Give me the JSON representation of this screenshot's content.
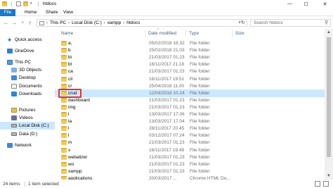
{
  "window": {
    "title": "htdocs",
    "controls": [
      "minimize",
      "maximize",
      "close"
    ],
    "minimize_glyph": "—",
    "maximize_glyph": "☐",
    "close_glyph": "✕"
  },
  "ribbon": {
    "tabs": [
      "File",
      "Home",
      "Share",
      "View"
    ]
  },
  "address_bar": {
    "back_glyph": "←",
    "forward_glyph": "→",
    "dropdown_glyph": "∨",
    "up_glyph": "↑",
    "crumbs": [
      "This PC",
      "Local Disk (C:)",
      "xampp",
      "htdocs"
    ],
    "separator": "›",
    "end_glyph": "∨",
    "refresh_glyph": "↻"
  },
  "search": {
    "placeholder": "Search htdocs",
    "icon": "search-icon",
    "glyph": "⚲"
  },
  "nav_pane": {
    "items": [
      {
        "label": "Quick access",
        "icon": "star-icon"
      },
      {
        "label": "OneDrive",
        "icon": "cloud-icon"
      },
      {
        "label": "This PC",
        "icon": "computer-icon"
      },
      {
        "label": "3D Objects",
        "icon": "cube-icon"
      },
      {
        "label": "Desktop",
        "icon": "desktop-icon"
      },
      {
        "label": "Documents",
        "icon": "documents-icon"
      },
      {
        "label": "Downloads",
        "icon": "download-icon"
      },
      {
        "label": "Pictures",
        "icon": "pictures-icon"
      },
      {
        "label": "Videos",
        "icon": "videos-icon"
      },
      {
        "label": "Local Disk (C:)",
        "icon": "disk-icon"
      },
      {
        "label": "Data (D:)",
        "icon": "disk-icon"
      },
      {
        "label": "Network",
        "icon": "network-icon"
      }
    ],
    "selected": "Local Disk (C:)"
  },
  "columns": {
    "name": "Name",
    "date_modified": "Date modified",
    "type": "Type",
    "size": "Size",
    "sort_glyph": "^"
  },
  "files": [
    {
      "name": "a,",
      "date": "05/02/2018 16.32",
      "type": "File folder"
    },
    {
      "name": "b",
      "date": "25/02/2018 21.03",
      "type": "File folder"
    },
    {
      "name": "bi",
      "date": "21/03/2017 01.23",
      "type": "File folder"
    },
    {
      "name": "bl",
      "date": "16/11/2017 21.16",
      "type": "File folder"
    },
    {
      "name": "ca",
      "date": "21/03/2017 01.23",
      "type": "File folder"
    },
    {
      "name": "cil",
      "date": "16/11/2017 19.51",
      "type": "File folder"
    },
    {
      "name": "cr",
      "date": "25/04/2018 11.00",
      "type": "File folder"
    },
    {
      "name": "crud",
      "date": "12/04/2018 10.24",
      "type": "File folder",
      "selected": true
    },
    {
      "name": "dashboard",
      "date": "21/03/2017 01.23",
      "type": "File folder"
    },
    {
      "name": "img",
      "date": "21/03/2017 01.23",
      "type": "File folder"
    },
    {
      "name": "l",
      "date": "13/03/2017 17.06",
      "type": "File folder"
    },
    {
      "name": "la",
      "date": "13/03/2017 17.04",
      "type": "File folder"
    },
    {
      "name": "l",
      "date": "28/11/2017 20.45",
      "type": "File folder"
    },
    {
      "name": "l",
      "date": "03/12/2017 07.24",
      "type": "File folder"
    },
    {
      "name": "m",
      "date": "21/03/2017 01.23",
      "type": "File folder"
    },
    {
      "name": "s",
      "date": "16/11/2017 19.49",
      "type": "File folder"
    },
    {
      "name": "webalizer",
      "date": "21/03/2017 01.23",
      "type": "File folder"
    },
    {
      "name": "wo",
      "date": "21/03/2017 01.23",
      "type": "File folder"
    },
    {
      "name": "xampp",
      "date": "21/03/2017 01.23",
      "type": "File folder"
    },
    {
      "name": "applications",
      "date": "20/03/2017 ...",
      "type": "Chrome HTML Do..."
    }
  ],
  "status_bar": {
    "item_count": "24 items",
    "selection": "1 item selected"
  },
  "scrollbar": {
    "up_glyph": "▲",
    "down_glyph": "▼"
  }
}
